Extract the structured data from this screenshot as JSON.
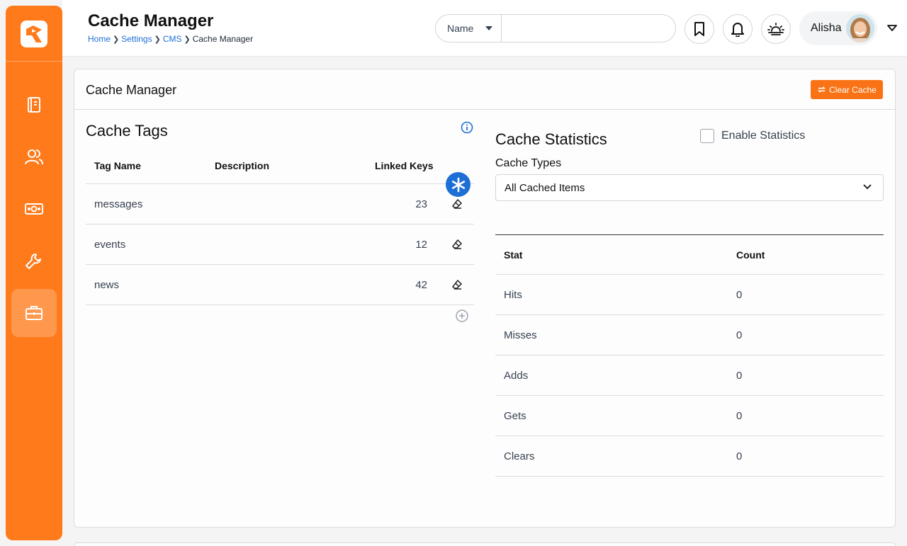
{
  "header": {
    "title": "Cache Manager",
    "breadcrumb": [
      "Home",
      "Settings",
      "CMS",
      "Cache Manager"
    ],
    "search": {
      "filter": "Name",
      "placeholder": ""
    },
    "user": {
      "name": "Alisha"
    }
  },
  "sidebar": {
    "items": [
      {
        "icon": "notebook-icon",
        "name": "sidebar-item-notebook"
      },
      {
        "icon": "users-icon",
        "name": "sidebar-item-users"
      },
      {
        "icon": "money-icon",
        "name": "sidebar-item-finance"
      },
      {
        "icon": "wrench-icon",
        "name": "sidebar-item-tools"
      },
      {
        "icon": "briefcase-icon",
        "name": "sidebar-item-briefcase",
        "active": true
      }
    ]
  },
  "card": {
    "title": "Cache Manager",
    "clear_button": "Clear Cache"
  },
  "tags": {
    "title": "Cache Tags",
    "columns": [
      "Tag Name",
      "Description",
      "Linked Keys"
    ],
    "rows": [
      {
        "name": "messages",
        "description": "",
        "keys": "23"
      },
      {
        "name": "events",
        "description": "",
        "keys": "12"
      },
      {
        "name": "news",
        "description": "",
        "keys": "42"
      }
    ]
  },
  "stats": {
    "title": "Cache Statistics",
    "enable_label": "Enable Statistics",
    "types_label": "Cache Types",
    "types_value": "All Cached Items",
    "columns": [
      "Stat",
      "Count"
    ],
    "rows": [
      {
        "stat": "Hits",
        "count": "0"
      },
      {
        "stat": "Misses",
        "count": "0"
      },
      {
        "stat": "Adds",
        "count": "0"
      },
      {
        "stat": "Gets",
        "count": "0"
      },
      {
        "stat": "Clears",
        "count": "0"
      }
    ]
  },
  "colors": {
    "brand": "#ff7a1a",
    "link": "#1d6fd6",
    "button": "#f97316"
  }
}
